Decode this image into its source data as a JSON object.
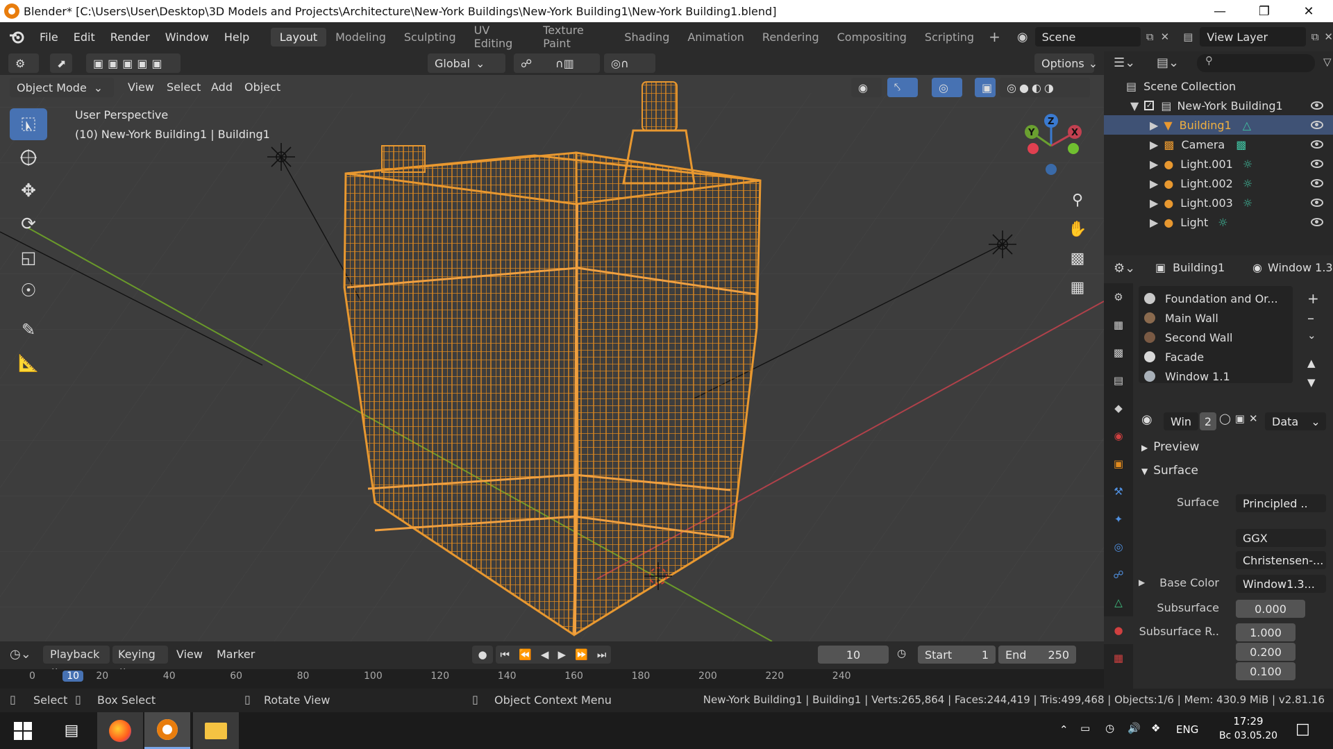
{
  "window": {
    "title": "Blender* [C:\\Users\\User\\Desktop\\3D Models and Projects\\Architecture\\New-York Buildings\\New-York Building1\\New-York Building1.blend]"
  },
  "menu": [
    "File",
    "Edit",
    "Render",
    "Window",
    "Help"
  ],
  "workspaces": [
    "Layout",
    "Modeling",
    "Sculpting",
    "UV Editing",
    "Texture Paint",
    "Shading",
    "Animation",
    "Rendering",
    "Compositing",
    "Scripting"
  ],
  "active_workspace": "Layout",
  "scene_name": "Scene",
  "view_layer": "View Layer",
  "tool_header": {
    "orientation": "Global",
    "options": "Options"
  },
  "view_header": {
    "mode": "Object Mode",
    "items": [
      "View",
      "Select",
      "Add",
      "Object"
    ]
  },
  "viewport": {
    "perspective": "User Perspective",
    "object_info": "(10) New-York Building1 | Building1",
    "gizmo_axes": [
      "X",
      "Y",
      "Z"
    ],
    "colors": {
      "wire": "#e08a1e",
      "grid": "#3d3d3d",
      "x_axis": "#b0414a",
      "y_axis": "#6a9a2a"
    }
  },
  "outliner": {
    "root": "Scene Collection",
    "items": [
      {
        "name": "New-York Building1",
        "selected": false
      },
      {
        "name": "Building1",
        "selected": true
      },
      {
        "name": "Camera",
        "selected": false
      },
      {
        "name": "Light.001",
        "selected": false
      },
      {
        "name": "Light.002",
        "selected": false
      },
      {
        "name": "Light.003",
        "selected": false
      },
      {
        "name": "Light",
        "selected": false
      }
    ]
  },
  "properties": {
    "object": "Building1",
    "material_header": "Window 1.3",
    "materials": [
      {
        "name": "Foundation and Or...",
        "color": "#c9c9c9"
      },
      {
        "name": "Main Wall",
        "color": "#8a6a4e"
      },
      {
        "name": "Second Wall",
        "color": "#7a5a44"
      },
      {
        "name": "Facade",
        "color": "#d8d8d8"
      },
      {
        "name": "Window 1.1",
        "color": "#a8b0b8"
      }
    ],
    "slot": {
      "name": "Win",
      "users": "2",
      "link": "Data"
    },
    "panels": {
      "preview": "Preview",
      "surface": "Surface"
    },
    "surface": {
      "surface_label": "Surface",
      "surface_value": "Principled ..",
      "distribution": "GGX",
      "subsurface_method": "Christensen-...",
      "base_color_label": "Base Color",
      "base_color_value": "Window1.3...",
      "subsurface_label": "Subsurface",
      "subsurface_value": "0.000",
      "subsurface_r_label": "Subsurface R..",
      "subsurface_r_values": [
        "1.000",
        "0.200",
        "0.100"
      ]
    }
  },
  "timeline": {
    "menus": [
      "Playback",
      "Keying",
      "View",
      "Marker"
    ],
    "current_frame": "10",
    "start_label": "Start",
    "start": "1",
    "end_label": "End",
    "end": "250",
    "ticks": [
      "0",
      "10",
      "20",
      "40",
      "60",
      "80",
      "100",
      "120",
      "140",
      "160",
      "180",
      "200",
      "220",
      "240"
    ]
  },
  "status": {
    "select": "Select",
    "box_select": "Box Select",
    "rotate_view": "Rotate View",
    "context_menu": "Object Context Menu",
    "stats": "New-York Building1 | Building1 | Verts:265,864 | Faces:244,419 | Tris:499,468 | Objects:1/6 | Mem: 430.9 MiB | v2.81.16"
  },
  "taskbar": {
    "lang": "ENG",
    "time": "17:29",
    "date": "Вс 03.05.20"
  }
}
